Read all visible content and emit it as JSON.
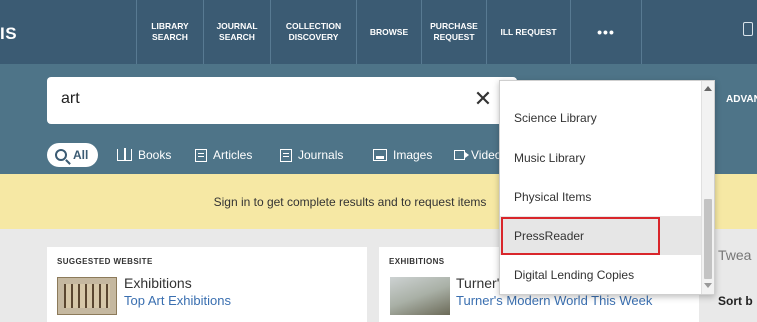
{
  "app": {
    "logo_text": "IS"
  },
  "nav": {
    "items": [
      {
        "label": "LIBRARY\nSEARCH"
      },
      {
        "label": "JOURNAL\nSEARCH"
      },
      {
        "label": "COLLECTION\nDISCOVERY"
      },
      {
        "label": "BROWSE"
      },
      {
        "label": "PURCHASE\nREQUEST"
      },
      {
        "label": "ILL REQUEST"
      },
      {
        "label": "•••"
      }
    ]
  },
  "search": {
    "query": "art",
    "clear_glyph": "✕",
    "advanced_label": "ADVAN"
  },
  "filters": [
    {
      "label": "All",
      "icon": "search-icon"
    },
    {
      "label": "Books",
      "icon": "book-icon"
    },
    {
      "label": "Articles",
      "icon": "article-icon"
    },
    {
      "label": "Journals",
      "icon": "journal-icon"
    },
    {
      "label": "Images",
      "icon": "image-icon"
    },
    {
      "label": "Video",
      "icon": "video-icon"
    }
  ],
  "banner": {
    "text": "Sign in to get complete results and to request items"
  },
  "cards": [
    {
      "label": "SUGGESTED WEBSITE",
      "title": "Exhibitions",
      "link": "Top Art Exhibitions"
    },
    {
      "label": "EXHIBITIONS",
      "title": "Turner's",
      "link": "Turner's Modern World This Week"
    }
  ],
  "right_panel": {
    "tease": "Twea",
    "sort": "Sort b"
  },
  "dropdown": {
    "items": [
      {
        "label": "Science Library"
      },
      {
        "label": "Music Library"
      },
      {
        "label": "Physical Items"
      },
      {
        "label": "PressReader"
      },
      {
        "label": "Digital Lending Copies"
      }
    ],
    "highlighted_index": 3
  },
  "colors": {
    "nav_bg": "#3b5b73",
    "search_band_bg": "#4e7488",
    "banner_bg": "#f6e8a4",
    "link": "#3a6fb0",
    "highlight_border": "#d9262b"
  }
}
